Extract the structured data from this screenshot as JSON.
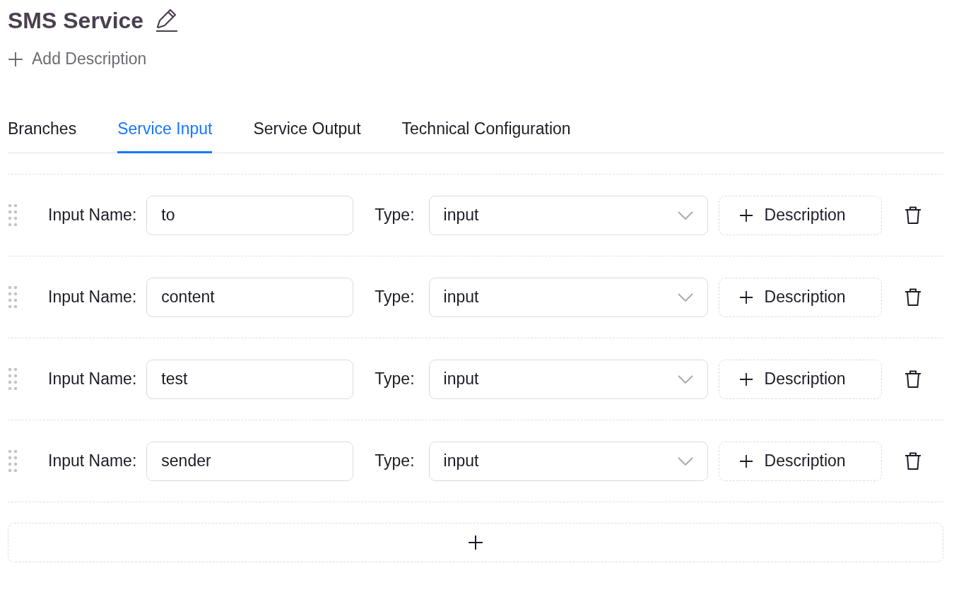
{
  "header": {
    "title": "SMS Service",
    "add_description": "Add Description"
  },
  "tabs": [
    {
      "label": "Branches",
      "selected": false
    },
    {
      "label": "Service Input",
      "selected": true
    },
    {
      "label": "Service Output",
      "selected": false
    },
    {
      "label": "Technical Configuration",
      "selected": false
    }
  ],
  "inputs": [
    {
      "name_label": "Input Name:",
      "name_value": "to",
      "type_label": "Type:",
      "type_value": "input",
      "description_button": "Description"
    },
    {
      "name_label": "Input Name:",
      "name_value": "content",
      "type_label": "Type:",
      "type_value": "input",
      "description_button": "Description"
    },
    {
      "name_label": "Input Name:",
      "name_value": "test",
      "type_label": "Type:",
      "type_value": "input",
      "description_button": "Description"
    },
    {
      "name_label": "Input Name:",
      "name_value": "sender",
      "type_label": "Type:",
      "type_value": "input",
      "description_button": "Description"
    }
  ]
}
